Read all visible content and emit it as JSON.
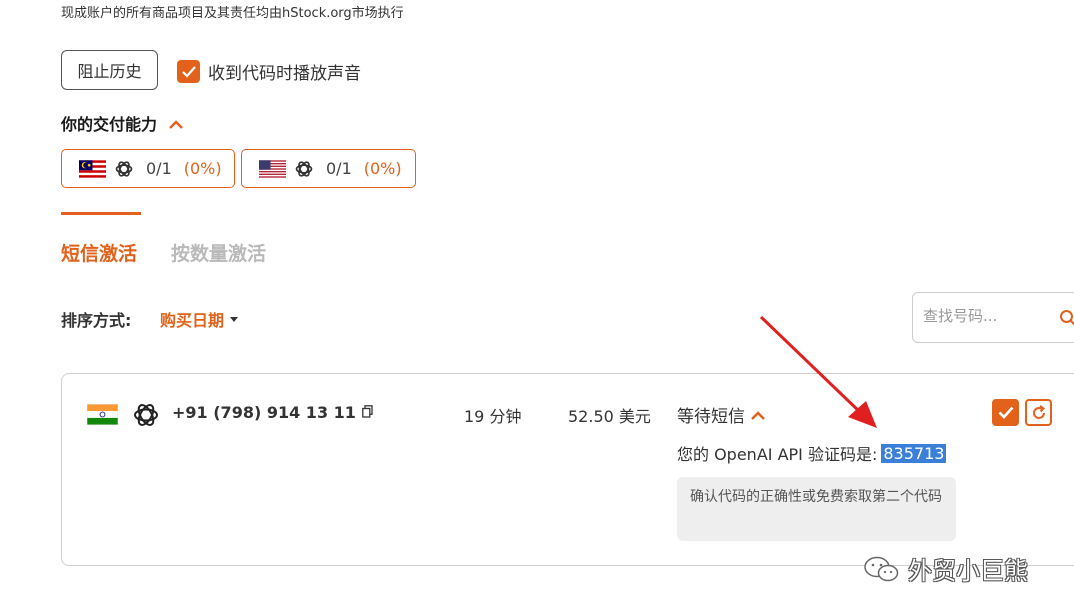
{
  "top_note": "现成账户的所有商品项目及其责任均由hStock.org市场执行",
  "controls": {
    "block_history_label": "阻止历史",
    "play_sound_label": "收到代码时播放声音",
    "play_sound_checked": true
  },
  "capability": {
    "title": "你的交付能力",
    "cards": [
      {
        "flag": "malaysia-flag-icon",
        "service": "openai-icon",
        "count": "0/1",
        "percent": "(0%)"
      },
      {
        "flag": "usa-flag-icon",
        "service": "openai-icon",
        "count": "0/1",
        "percent": "(0%)"
      }
    ]
  },
  "tabs": [
    {
      "label": "短信激活",
      "active": true
    },
    {
      "label": "按数量激活",
      "active": false
    }
  ],
  "sort": {
    "label": "排序方式:",
    "value": "购买日期"
  },
  "search": {
    "placeholder": "查找号码..."
  },
  "order": {
    "country_flag": "india-flag-icon",
    "service_icon": "openai-icon",
    "phone": "+91 (798) 914 13 11",
    "duration": "19 分钟",
    "price": "52.50 美元",
    "status": "等待短信",
    "code_prefix": "您的 OpenAI API 验证码是:",
    "code": "835713",
    "hint": "确认代码的正确性或免费索取第二个代码"
  },
  "watermark": {
    "text": "外贸小巨熊"
  },
  "colors": {
    "accent": "#e2621b",
    "arrow": "#e02020",
    "highlight": "#3b7fd9"
  }
}
